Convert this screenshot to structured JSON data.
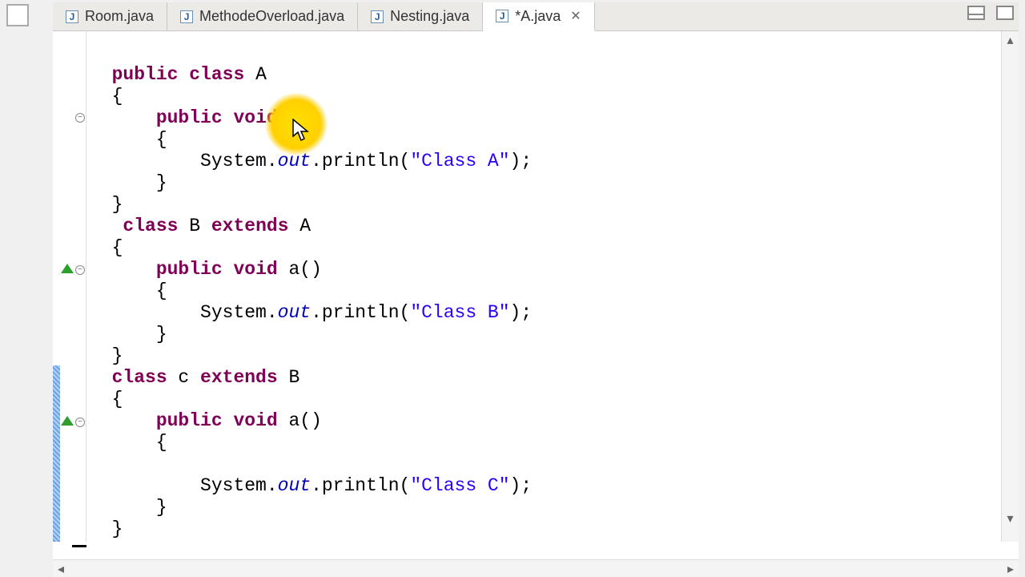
{
  "tabs": [
    {
      "label": "Room.java",
      "active": false,
      "dirty": false
    },
    {
      "label": "MethodeOverload.java",
      "active": false,
      "dirty": false
    },
    {
      "label": "Nesting.java",
      "active": false,
      "dirty": false
    },
    {
      "label": "*A.java",
      "active": true,
      "dirty": true
    }
  ],
  "icons": {
    "java_letter": "J"
  },
  "code": {
    "l1": {
      "kw1": "public",
      "kw2": "class",
      "name": " A"
    },
    "l2": "{",
    "l3": {
      "kw1": "public",
      "kw2": "void",
      "sig": " a()"
    },
    "l4": "{",
    "l5": {
      "pre": "System.",
      "out": "out",
      "mid": ".println(",
      "str": "\"Class A\"",
      "post": ");"
    },
    "l6": "}",
    "l7": "}",
    "l8": {
      "kw1": "class",
      "name": " B ",
      "kw2": "extends",
      "sup": " A"
    },
    "l9": "{",
    "l10": {
      "kw1": "public",
      "kw2": "void",
      "sig": " a()"
    },
    "l11": "{",
    "l12": {
      "pre": "System.",
      "out": "out",
      "mid": ".println(",
      "str": "\"Class B\"",
      "post": ");"
    },
    "l13": "}",
    "l14": "}",
    "l15": {
      "kw1": "class",
      "name": " c ",
      "kw2": "extends",
      "sup": " B"
    },
    "l16": "{",
    "l17": {
      "kw1": "public",
      "kw2": "void",
      "sig": " a()"
    },
    "l18": "{",
    "l19": "",
    "l20": {
      "pre": "System.",
      "out": "out",
      "mid": ".println(",
      "str": "\"Class C\"",
      "post": ");"
    },
    "l21": "}",
    "l22": "}"
  }
}
